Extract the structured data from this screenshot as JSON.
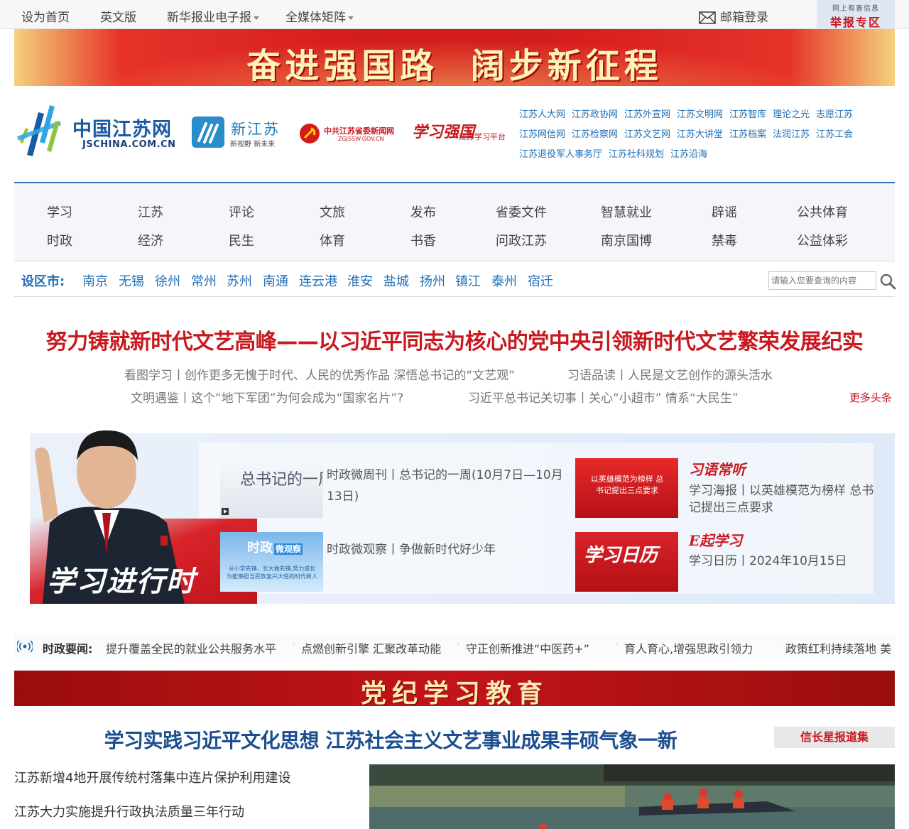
{
  "topbar": {
    "set_home": "设为首页",
    "english": "英文版",
    "epaper": "新华报业电子报",
    "matrix": "全媒体矩阵",
    "mail_login": "邮箱登录",
    "report_top": "网上有害信息",
    "report_main": "举报专区"
  },
  "banner": {
    "text": "奋进强国路  阔步新征程"
  },
  "logos": {
    "jschina_name": "中国江苏网",
    "jschina_domain": "JSCHINA.COM.CN",
    "xjs_name": "新江苏",
    "xjs_slogan": "新视野 新未来",
    "zgjssw_name": "中共江苏省委新闻网",
    "zgjssw_domain": "ZGJSSW.GOV.CN",
    "xxqg_brand": "学习强国",
    "xxqg_sub": "江苏学习平台"
  },
  "sitelinks": [
    [
      "江苏人大网",
      "江苏政协网",
      "江苏外宣网",
      "江苏文明网",
      "江苏智库",
      "理论之光",
      "志愿江苏"
    ],
    [
      "江苏网信网",
      "江苏检察网",
      "江苏文艺网",
      "江苏大讲堂",
      "江苏档案",
      "法润江苏",
      "江苏工会"
    ],
    [
      "江苏退役军人事务厅",
      "江苏社科规划",
      "江苏沿海"
    ]
  ],
  "nav": [
    [
      "学习",
      "时政"
    ],
    [
      "江苏",
      "经济"
    ],
    [
      "评论",
      "民生"
    ],
    [
      "文旅",
      "体育"
    ],
    [
      "发布",
      "书香"
    ],
    [
      "省委文件",
      "问政江苏"
    ],
    [
      "智慧就业",
      "南京国博"
    ],
    [
      "辟谣",
      "禁毒"
    ],
    [
      "公共体育",
      "公益体彩"
    ]
  ],
  "cities": {
    "label": "设区市:",
    "list": [
      "南京",
      "无锡",
      "徐州",
      "常州",
      "苏州",
      "南通",
      "连云港",
      "淮安",
      "盐城",
      "扬州",
      "镇江",
      "泰州",
      "宿迁"
    ],
    "search_placeholder": "请输入您要查询的内容"
  },
  "headline": {
    "title": "努力铸就新时代文艺高峰——以习近平同志为核心的党中央引领新时代文艺繁荣发展纪实",
    "sub1": "看图学习丨创作更多无愧于时代、人民的优秀作品 深悟总书记的“文艺观”",
    "sub2": "习语品读丨人民是文艺创作的源头活水",
    "sub3": "文明遇鉴丨这个“地下军团”为何会成为“国家名片”?",
    "sub4": "习近平总书记关切事丨关心“小超市” 情系“大民生”",
    "more": "更多头条"
  },
  "study": {
    "brand": "学习进行时",
    "item1_thumb": "总书记的一周",
    "item1_text": "时政微周刊丨总书记的一周(10月7日—10月13日)",
    "item2_thumb_title": "时政",
    "item2_thumb_badge": "微观察",
    "item2_thumb_text": "从小学先锋、长大做先锋,努力成长为能够担当民族复兴大任的时代新人",
    "item2_text": "时政微观察丨争做新时代好少年",
    "item3_thumb": "以英雄模范为榜样 总书记提出三点要求",
    "item3_brand": "习语常听",
    "item3_text": "学习海报丨以英雄模范为榜样 总书记提出三点要求",
    "item4_thumb": "学习日历",
    "item4_brand": "E起学习",
    "item4_text": "学习日历丨2024年10月15日"
  },
  "ticker": {
    "label": "时政要闻:",
    "items": [
      "提升覆盖全民的就业公共服务水平",
      "点燃创新引擎 汇聚改革动能",
      "守正创新推进“中医药+”",
      "育人育心,增强思政引领力",
      "政策红利持续落地 美"
    ]
  },
  "party_banner": {
    "text": "党纪学习教育"
  },
  "section": {
    "title": "学习实践习近平文化思想 江苏社会主义文艺事业成果丰硕气象一新",
    "side_button": "信长星报道集",
    "news": [
      "江苏新增4地开展传统村落集中连片保护利用建设",
      "江苏大力实施提升行政执法质量三年行动"
    ]
  },
  "colors": {
    "brand_red": "#c8191f",
    "link_blue": "#1f6fb6",
    "title_blue": "#1a4e8f"
  }
}
